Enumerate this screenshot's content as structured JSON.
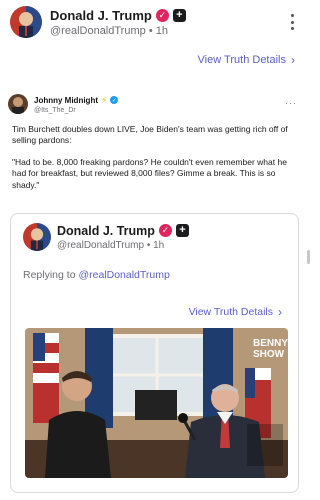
{
  "post": {
    "display_name": "Donald J. Trump",
    "handle": "@realDonaldTrump",
    "time": "1h",
    "separator": "•",
    "view_details": "View Truth Details"
  },
  "tweet": {
    "display_name": "Johnny Midnight",
    "handle": "@Its_The_Dr",
    "paragraphs": [
      "Tim Burchett doubles down LIVE, Joe Biden's team was getting rich off of selling pardons:",
      "\"Had to be. 8,000 freaking pardons? He couldn't even remember what he had for breakfast, but reviewed 8,000 files? Gimme a break. This is so shady.\""
    ]
  },
  "quote": {
    "display_name": "Donald J. Trump",
    "handle": "@realDonaldTrump",
    "time": "1h",
    "separator": "•",
    "replying_prefix": "Replying to",
    "replying_handle": "@realDonaldTrump",
    "view_details": "View Truth Details",
    "video_watermark": [
      "BENNY",
      "SHOW"
    ]
  },
  "icons": {
    "verified": "verified-check-icon",
    "plus": "truth-plus-badge-icon",
    "menu": "kebab-menu-icon",
    "chevron": "chevron-right-icon",
    "bolt": "lightning-bolt-icon",
    "more": "more-horizontal-icon"
  },
  "colors": {
    "link": "#5b5fc7",
    "verified_badge": "#e0245e",
    "twitter_verified": "#1d9bf0"
  }
}
